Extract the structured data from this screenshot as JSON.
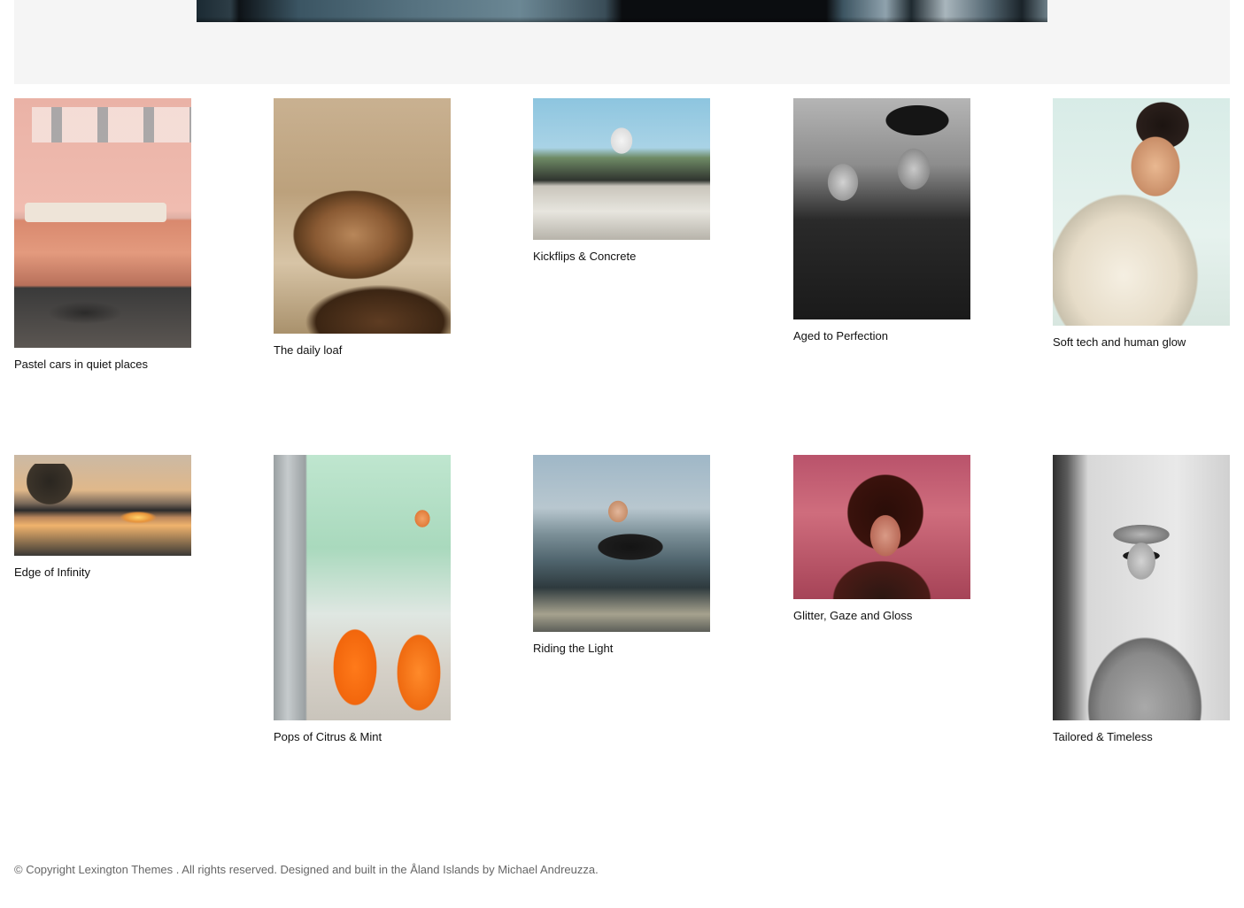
{
  "gallery": {
    "items": [
      {
        "caption": "Pastel cars in quiet places"
      },
      {
        "caption": "The daily loaf"
      },
      {
        "caption": "Kickflips & Concrete"
      },
      {
        "caption": "Aged to Perfection"
      },
      {
        "caption": "Soft tech and human glow"
      },
      {
        "caption": "Edge of Infinity"
      },
      {
        "caption": "Pops of Citrus & Mint"
      },
      {
        "caption": "Riding the Light"
      },
      {
        "caption": "Glitter, Gaze and Gloss"
      },
      {
        "caption": "Tailored & Timeless"
      }
    ]
  },
  "footer": {
    "text": "© Copyright Lexington Themes . All rights reserved. Designed and built in the Åland Islands by Michael Andreuzza."
  }
}
